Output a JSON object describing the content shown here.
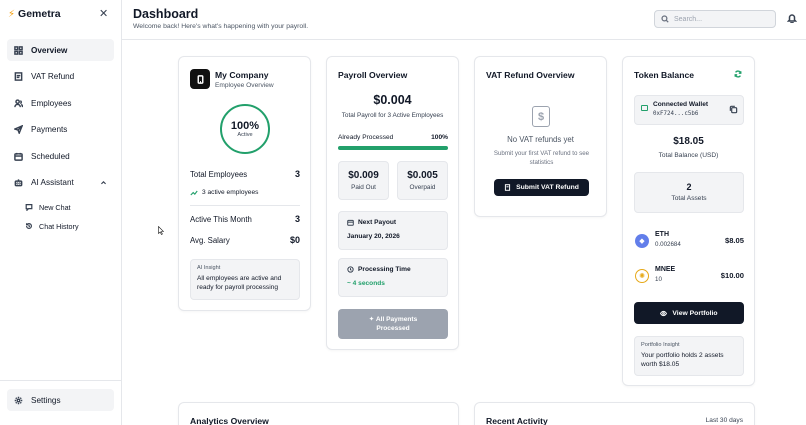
{
  "brand": {
    "name": "Gemetra"
  },
  "sidebar": {
    "items": [
      {
        "label": "Overview",
        "icon": "grid-icon"
      },
      {
        "label": "VAT Refund",
        "icon": "receipt-icon"
      },
      {
        "label": "Employees",
        "icon": "users-icon"
      },
      {
        "label": "Payments",
        "icon": "send-icon"
      },
      {
        "label": "Scheduled",
        "icon": "calendar-icon"
      },
      {
        "label": "AI Assistant",
        "icon": "bot-icon"
      }
    ],
    "sub_items": [
      {
        "label": "New Chat",
        "icon": "chat-icon"
      },
      {
        "label": "Chat History",
        "icon": "history-icon"
      }
    ],
    "settings_label": "Settings"
  },
  "header": {
    "title": "Dashboard",
    "subtitle": "Welcome back! Here's what's happening with your payroll.",
    "search_placeholder": "Search..."
  },
  "company": {
    "name": "My Company",
    "subtitle": "Employee Overview",
    "active_pct": "100%",
    "active_label": "Active",
    "total_employees_label": "Total Employees",
    "total_employees": "3",
    "active_employees": "3 active employees",
    "active_month_label": "Active This Month",
    "active_month": "3",
    "avg_salary_label": "Avg. Salary",
    "avg_salary": "$0",
    "insight_title": "AI Insight",
    "insight_text": "All employees are active and ready for payroll processing"
  },
  "payroll": {
    "title": "Payroll Overview",
    "amount": "$0.004",
    "subtitle": "Total Payroll for 3 Active Employees",
    "processed_label": "Already Processed",
    "processed_pct": "100%",
    "processed_fraction": 1.0,
    "paid_out": "$0.009",
    "paid_out_label": "Paid Out",
    "overpaid": "$0.005",
    "overpaid_label": "Overpaid",
    "next_payout_label": "Next Payout",
    "next_payout": "January 20, 2026",
    "processing_label": "Processing Time",
    "processing_time": "~ 4 seconds",
    "button_line1": "All Payments",
    "button_line2": "Processed"
  },
  "vat": {
    "title": "VAT Refund Overview",
    "empty": "No VAT refunds yet",
    "hint": "Submit your first VAT refund to see statistics",
    "button": "Submit VAT Refund"
  },
  "token": {
    "title": "Token Balance",
    "wallet_label": "Connected Wallet",
    "wallet_address": "0xF724...c5b6",
    "balance": "$18.05",
    "balance_label": "Total Balance (USD)",
    "total_assets": "2",
    "total_assets_label": "Total Assets",
    "assets": [
      {
        "symbol": "ETH",
        "amount": "0.002684",
        "value": "$8.05",
        "color": "#627eea"
      },
      {
        "symbol": "MNEE",
        "amount": "10",
        "value": "$10.00",
        "color": "#e6a817"
      }
    ],
    "portfolio_button": "View Portfolio",
    "insight_title": "Portfolio Insight",
    "insight_text": "Your portfolio holds 2 assets worth $18.05"
  },
  "bottom": {
    "analytics_title": "Analytics Overview",
    "recent_title": "Recent Activity",
    "recent_range": "Last 30 days"
  },
  "colors": {
    "accent": "#22a06b",
    "dark": "#111827",
    "muted": "#f3f4f6"
  }
}
